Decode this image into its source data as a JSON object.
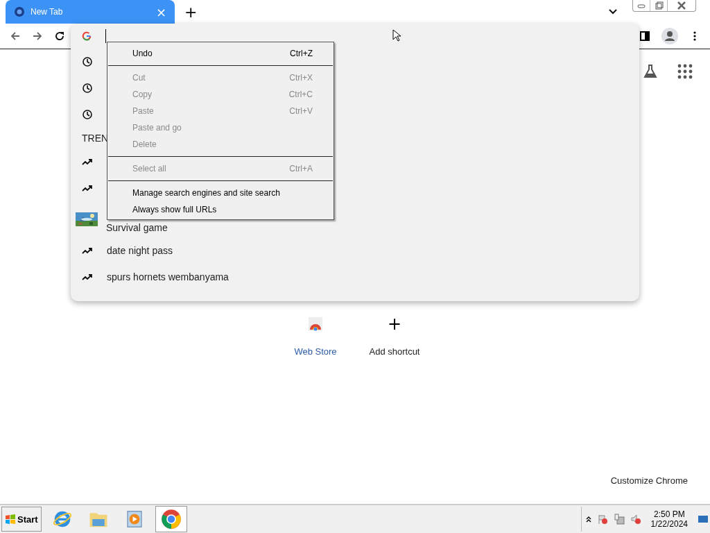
{
  "tabs": [
    {
      "title": "New Tab",
      "close": "×",
      "selected": true
    }
  ],
  "new_tab": "+",
  "suggestions": [
    {
      "kind": "history"
    },
    {
      "kind": "history"
    },
    {
      "kind": "history"
    },
    {
      "kind": "heading",
      "text": "TREN"
    },
    {
      "kind": "trend"
    },
    {
      "kind": "trend"
    },
    {
      "kind": "entity",
      "subtitle": "Survival game"
    },
    {
      "kind": "trend",
      "text": "date night pass"
    },
    {
      "kind": "trend",
      "text": "spurs hornets wembanyama"
    }
  ],
  "context_menu": [
    {
      "kind": "item",
      "label": "Undo",
      "shortcut": "Ctrl+Z",
      "disabled": false
    },
    {
      "kind": "separator"
    },
    {
      "kind": "item",
      "label": "Cut",
      "shortcut": "Ctrl+X",
      "disabled": true
    },
    {
      "kind": "item",
      "label": "Copy",
      "shortcut": "Ctrl+C",
      "disabled": true
    },
    {
      "kind": "item",
      "label": "Paste",
      "shortcut": "Ctrl+V",
      "disabled": true
    },
    {
      "kind": "item",
      "label": "Paste and go",
      "disabled": true
    },
    {
      "kind": "item",
      "label": "Delete",
      "disabled": true
    },
    {
      "kind": "separator"
    },
    {
      "kind": "item",
      "label": "Select all",
      "shortcut": "Ctrl+A",
      "disabled": true
    },
    {
      "kind": "separator"
    },
    {
      "kind": "item",
      "label": "Manage search engines and site search",
      "disabled": false
    },
    {
      "kind": "item",
      "label": "Always show full URLs",
      "disabled": false
    }
  ],
  "shortcuts": [
    {
      "kind": "webstore",
      "label": "Web Store"
    },
    {
      "kind": "add",
      "icon": "+",
      "label": "Add shortcut"
    }
  ],
  "customize": "Customize Chrome",
  "taskbar": {
    "start": "Start",
    "apps": [
      {
        "kind": "ie",
        "selected": false
      },
      {
        "kind": "explorer",
        "selected": false
      },
      {
        "kind": "media",
        "selected": false
      },
      {
        "kind": "chrome",
        "selected": true
      }
    ],
    "time": "2:50 PM",
    "date": "1/22/2024"
  }
}
